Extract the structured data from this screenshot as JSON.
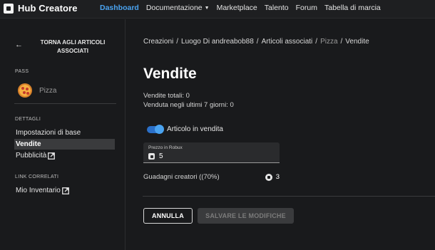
{
  "app": {
    "brand": "Hub Creatore"
  },
  "nav": {
    "items": [
      {
        "label": "Dashboard",
        "active": true
      },
      {
        "label": "Documentazione",
        "has_dropdown": true
      },
      {
        "label": "Marketplace"
      },
      {
        "label": "Talento"
      },
      {
        "label": "Forum"
      },
      {
        "label": "Tabella di marcia"
      }
    ]
  },
  "sidebar": {
    "back_label": "TORNA AGLI ARTICOLI ASSOCIATI",
    "pass_section": "PASS",
    "pass_name": "Pizza",
    "details_section": "DETTAGLI",
    "items": [
      {
        "label": "Impostazioni di base"
      },
      {
        "label": "Vendite",
        "selected": true
      },
      {
        "label": "Pubblicità",
        "external": true
      }
    ],
    "links_section": "LINK CORRELATI",
    "links": [
      {
        "label": "Mio Inventario",
        "external": true
      }
    ]
  },
  "breadcrumb": {
    "items": [
      "Creazioni",
      "Luogo Di andreabob88",
      "Articoli associati",
      "Pizza",
      "Vendite"
    ]
  },
  "main": {
    "title": "Vendite",
    "total_sales": "Vendite totali: 0",
    "weekly_sales": "Venduta negli ultimi 7 giorni: 0",
    "on_sale_label": "Articolo in vendita",
    "on_sale": true,
    "price_label": "Prezzo in Robux",
    "price_value": "5",
    "earnings_label": "Guadagni creatori ((70%)",
    "earnings_value": "3",
    "cancel_label": "ANNULLA",
    "save_label": "SALVARE LE MODIFICHE"
  },
  "colors": {
    "accent": "#4aa3f0",
    "background": "#191a1c"
  }
}
